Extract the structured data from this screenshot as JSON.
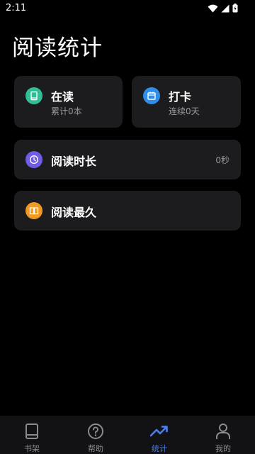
{
  "status_bar": {
    "time": "2:11"
  },
  "page": {
    "title": "阅读统计"
  },
  "cards": {
    "reading": {
      "title": "在读",
      "subtitle": "累计0本",
      "icon": "book-icon",
      "color": "#2fbf97"
    },
    "checkin": {
      "title": "打卡",
      "subtitle": "连续0天",
      "icon": "calendar-icon",
      "color": "#2e8ee8"
    },
    "duration": {
      "title": "阅读时长",
      "value": "0秒",
      "icon": "clock-icon",
      "color": "#6e5ce6"
    },
    "longest": {
      "title": "阅读最久",
      "icon": "open-book-icon",
      "color": "#f29a1f"
    }
  },
  "bottom_nav": {
    "items": [
      {
        "label": "书架",
        "icon": "bookshelf-icon",
        "active": false
      },
      {
        "label": "帮助",
        "icon": "help-icon",
        "active": false
      },
      {
        "label": "统计",
        "icon": "trending-up-icon",
        "active": true
      },
      {
        "label": "我的",
        "icon": "person-icon",
        "active": false
      }
    ],
    "active_color": "#4a7ff0"
  }
}
